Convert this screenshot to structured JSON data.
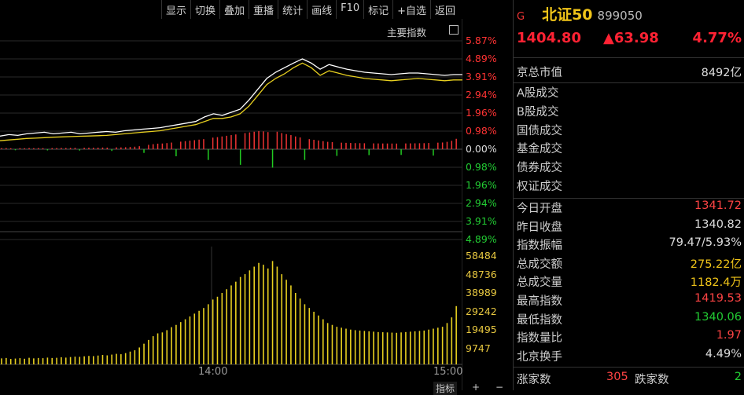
{
  "toolbar": {
    "display": "显示",
    "switch": "切换",
    "overlay": "叠加",
    "replay": "重播",
    "stats": "统计",
    "draw": "画线",
    "f10": "F10",
    "mark": "标记",
    "add_watch": "+自选",
    "back": "返回"
  },
  "chart": {
    "main_indicator": "主要指数",
    "pct_labels": [
      "5.87%",
      "4.89%",
      "3.91%",
      "2.94%",
      "1.96%",
      "0.98%",
      "0.00%",
      "0.98%",
      "1.96%",
      "2.94%",
      "3.91%",
      "4.89%"
    ],
    "pct_colors": [
      "#ff3333",
      "#ff3333",
      "#ff3333",
      "#ff3333",
      "#ff3333",
      "#ff3333",
      "#dddddd",
      "#22cc33",
      "#22cc33",
      "#22cc33",
      "#22cc33",
      "#22cc33"
    ],
    "vol_labels": [
      "58484",
      "48736",
      "38989",
      "29242",
      "19495",
      "9747"
    ],
    "time_labels": [
      "14:00",
      "15:00"
    ],
    "bottom_tab": "指标",
    "price_white": [
      0.85,
      0.95,
      0.9,
      1.0,
      1.05,
      1.1,
      1.0,
      1.05,
      1.1,
      1.0,
      1.05,
      1.1,
      1.15,
      1.1,
      1.2,
      1.25,
      1.3,
      1.35,
      1.4,
      1.5,
      1.6,
      1.7,
      1.8,
      2.1,
      2.3,
      2.2,
      2.4,
      2.6,
      3.2,
      3.9,
      4.6,
      5.0,
      5.3,
      5.6,
      5.87,
      5.6,
      5.2,
      5.5,
      5.35,
      5.2,
      5.1,
      5.0,
      4.95,
      4.9,
      4.85,
      4.9,
      4.95,
      4.95,
      4.9,
      4.85,
      4.8,
      4.85,
      4.85
    ],
    "price_yellow": [
      0.55,
      0.6,
      0.65,
      0.7,
      0.72,
      0.75,
      0.78,
      0.8,
      0.82,
      0.84,
      0.86,
      0.88,
      0.9,
      0.95,
      1.0,
      1.05,
      1.1,
      1.15,
      1.2,
      1.3,
      1.4,
      1.5,
      1.6,
      1.8,
      2.0,
      2.0,
      2.1,
      2.3,
      2.8,
      3.5,
      4.2,
      4.6,
      4.9,
      5.3,
      5.6,
      5.3,
      4.8,
      5.1,
      4.95,
      4.8,
      4.7,
      4.6,
      4.55,
      4.5,
      4.45,
      4.5,
      4.55,
      4.6,
      4.55,
      4.5,
      4.45,
      4.5,
      4.5
    ],
    "volume_values": [
      3200,
      3400,
      2900,
      3100,
      3300,
      3000,
      3500,
      3200,
      3400,
      3300,
      3600,
      3400,
      3500,
      3800,
      3600,
      3900,
      4100,
      4000,
      4300,
      4500,
      4400,
      4700,
      5000,
      4800,
      5200,
      5600,
      5400,
      6000,
      6800,
      7500,
      9000,
      11000,
      13000,
      15000,
      16500,
      17000,
      18200,
      19800,
      21000,
      22500,
      24000,
      25500,
      27000,
      28500,
      30000,
      32000,
      34500,
      36000,
      38000,
      40000,
      42000,
      44000,
      46500,
      48000,
      50000,
      52000,
      54000,
      53000,
      51000,
      55000,
      52000,
      48000,
      45000,
      42000,
      38000,
      35000,
      32000,
      30000,
      28000,
      26000,
      24000,
      22000,
      21000,
      20000,
      19500,
      19000,
      18500,
      18200,
      18000,
      17800,
      17600,
      17400,
      17200,
      17100,
      17000,
      16900,
      16800,
      17000,
      17200,
      17400,
      17600,
      17800,
      18000,
      18500,
      19000,
      19500,
      20000,
      22000,
      25000,
      31000
    ]
  },
  "panel": {
    "badge": "G",
    "name": "北证50",
    "code": "899050",
    "price": "1404.80",
    "change": "▲63.98",
    "change_pct": "4.77%",
    "market_cap_label": "京总市值",
    "market_cap_value": "8492亿",
    "turnover_labels": [
      "A股成交",
      "B股成交",
      "国债成交",
      "基金成交",
      "债券成交",
      "权证成交"
    ],
    "stats": [
      {
        "label": "今日开盘",
        "value": "1341.72",
        "color": "#ff4444"
      },
      {
        "label": "昨日收盘",
        "value": "1340.82",
        "color": "#dddddd"
      },
      {
        "label": "指数振幅",
        "value": "79.47/5.93%",
        "color": "#dddddd"
      },
      {
        "label": "总成交额",
        "value": "275.22亿",
        "color": "#f0c419"
      },
      {
        "label": "总成交量",
        "value": "1182.4万",
        "color": "#f0c419"
      },
      {
        "label": "最高指数",
        "value": "1419.53",
        "color": "#ff4444"
      },
      {
        "label": "最低指数",
        "value": "1340.06",
        "color": "#22cc33"
      },
      {
        "label": "指数量比",
        "value": "1.97",
        "color": "#ff4444"
      },
      {
        "label": "北京换手",
        "value": "4.49%",
        "color": "#dddddd"
      }
    ],
    "up_label": "涨家数",
    "up_count": "305",
    "down_label": "跌家数",
    "down_count": "2"
  }
}
